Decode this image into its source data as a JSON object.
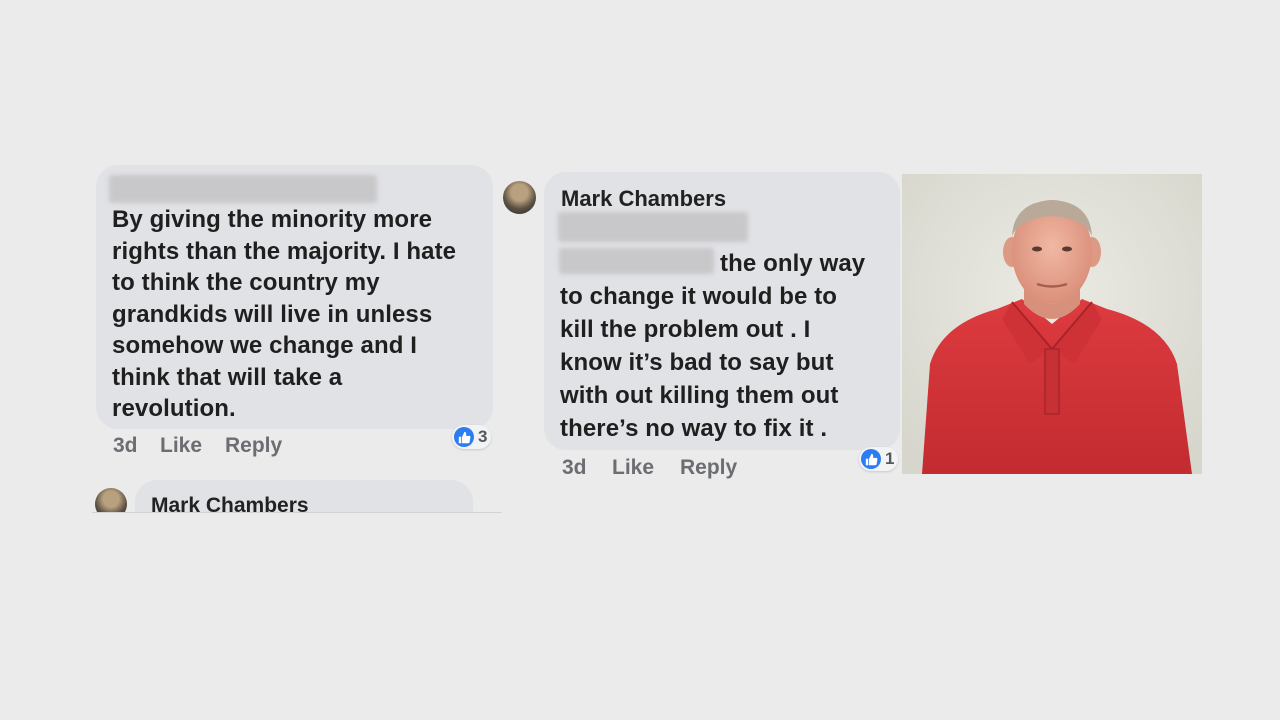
{
  "left_comment": {
    "text_lines": [
      "By giving the minority more",
      "rights than the majority. I hate",
      "to think the country my",
      "grandkids will live in unless",
      "somehow we change and I",
      "think that will take a",
      "revolution."
    ],
    "time": "3d",
    "like_label": "Like",
    "reply_label": "Reply",
    "reaction_count": "3"
  },
  "left_reply": {
    "name": "Mark Chambers"
  },
  "right_comment": {
    "name": "Mark Chambers",
    "text_lines": [
      "the only way",
      "to change it would be to",
      "kill the problem out . I",
      "know it’s bad to say but",
      "with out killing them out",
      "there’s no way to fix it ."
    ],
    "time": "3d",
    "like_label": "Like",
    "reply_label": "Reply",
    "reaction_count": "1"
  },
  "colors": {
    "background": "#ebebeb",
    "bubble": "#e1e2e6",
    "like_blue": "#2d7cf4",
    "shirt_red": "#d3373a"
  },
  "icons": {
    "reaction": "thumbs-up-icon"
  }
}
